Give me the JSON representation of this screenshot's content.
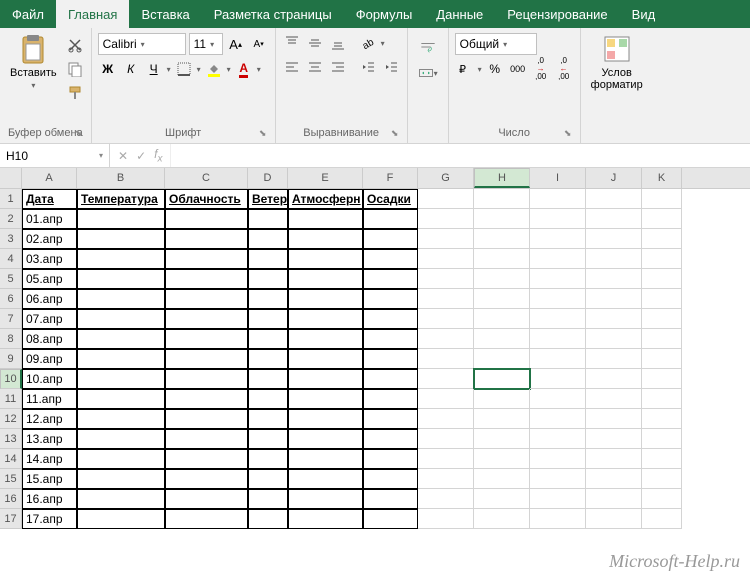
{
  "tabs": [
    "Файл",
    "Главная",
    "Вставка",
    "Разметка страницы",
    "Формулы",
    "Данные",
    "Рецензирование",
    "Вид"
  ],
  "activeTab": 1,
  "ribbon": {
    "clipboard": {
      "paste": "Вставить",
      "label": "Буфер обмена"
    },
    "font": {
      "name": "Calibri",
      "size": "11",
      "label": "Шрифт",
      "bold": "Ж",
      "italic": "К",
      "underline": "Ч"
    },
    "align": {
      "label": "Выравнивание"
    },
    "number": {
      "format": "Общий",
      "label": "Число",
      "pct": "%",
      "comma": "000",
      "dec1": ",0",
      "dec1b": ",00",
      "dec2": ",0",
      "dec2b": ",00"
    },
    "cond": {
      "line1": "Услов",
      "line2": "форматир"
    }
  },
  "namebox": "H10",
  "colWidths": {
    "A": 55,
    "B": 88,
    "C": 83,
    "D": 40,
    "E": 75,
    "F": 55,
    "G": 56,
    "H": 56,
    "I": 56,
    "J": 56,
    "K": 40
  },
  "columns": [
    "A",
    "B",
    "C",
    "D",
    "E",
    "F",
    "G",
    "H",
    "I",
    "J",
    "K"
  ],
  "headers": [
    "Дата",
    "Температура",
    "Облачность",
    "Ветер",
    "Атмосферн",
    "Осадки"
  ],
  "dataRows": [
    "01.апр",
    "02.апр",
    "03.апр",
    "05.апр",
    "06.апр",
    "07.апр",
    "08.апр",
    "09.апр",
    "10.апр",
    "11.апр",
    "12.апр",
    "13.апр",
    "14.апр",
    "15.апр",
    "16.апр",
    "17.апр"
  ],
  "activeCell": {
    "row": 10,
    "col": "H"
  },
  "watermark": "Microsoft-Help.ru"
}
